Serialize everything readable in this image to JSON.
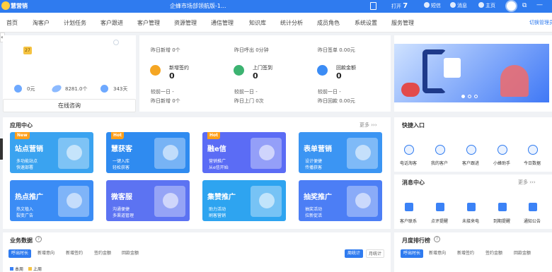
{
  "topbar": {
    "brand": "慧营销",
    "window_title": "企蜂市场部领航版-1...",
    "open_label": "打开",
    "open_count": "7",
    "items": [
      "短信",
      "消息",
      "主页"
    ]
  },
  "menu": {
    "items": [
      "首页",
      "淘客户",
      "计划任务",
      "客户跟进",
      "客户管理",
      "资源管理",
      "通信管理",
      "知识库",
      "统计分析",
      "成员角色",
      "系统设置",
      "服务管理"
    ],
    "right_link": "切换管理员"
  },
  "profile": {
    "badge": "27",
    "stats": [
      {
        "icon": "money-bag-icon",
        "value": "0元"
      },
      {
        "icon": "pill-icon",
        "value": "8281.0个"
      },
      {
        "icon": "clock-icon",
        "value": "343天"
      }
    ],
    "consult_label": "在线咨询"
  },
  "stats": {
    "top_row": [
      "昨日新增 0个",
      "昨日呼出 0分钟",
      "昨日签单 0.00元"
    ],
    "items": [
      {
        "name": "新增签约",
        "value": "0",
        "compare": "较前一日 -",
        "yesterday": "昨日新增 0个",
        "color": "#f5a623"
      },
      {
        "name": "上门签到",
        "value": "0",
        "compare": "较前一日 -",
        "yesterday": "昨日上门 0次",
        "color": "#3cb371"
      },
      {
        "name": "回款金额",
        "value": "0",
        "compare": "较前一日 -",
        "yesterday": "昨日回款 0.00元",
        "color": "#3b8cf5"
      }
    ]
  },
  "app_center": {
    "title": "应用中心",
    "more": "更多",
    "apps": [
      {
        "tag": "New",
        "name": "站点营销",
        "desc1": "多功能站点",
        "desc2": "快速部署",
        "color": "#3aa3f0"
      },
      {
        "tag": "Hot",
        "name": "慧获客",
        "desc1": "一键入库",
        "desc2": "轻松获客",
        "color": "#2f8bf0"
      },
      {
        "tag": "Hot",
        "name": "融e信",
        "desc1": "营销推广",
        "desc2": "从e信开始",
        "color": "#5b6cf5"
      },
      {
        "tag": "",
        "name": "表单营销",
        "desc1": "设计便捷",
        "desc2": "传播获客",
        "color": "#3b95f3"
      },
      {
        "tag": "",
        "name": "热点推广",
        "desc1": "热文植入",
        "desc2": "裂变广告",
        "color": "#3b8cf5"
      },
      {
        "tag": "",
        "name": "微客服",
        "desc1": "沟通便捷",
        "desc2": "多渠道管理",
        "color": "#5c73f2"
      },
      {
        "tag": "",
        "name": "集赞推广",
        "desc1": "助力活动",
        "desc2": "刷客营销",
        "color": "#2ea4f0"
      },
      {
        "tag": "",
        "name": "抽奖推广",
        "desc1": "抽奖活动",
        "desc2": "拉新促活",
        "color": "#4c7ef5"
      }
    ]
  },
  "quick_entry": {
    "title": "快捷入口",
    "items": [
      "电话淘客",
      "我的客户",
      "客户跟进",
      "小蜂助手",
      "今日数据"
    ]
  },
  "messages": {
    "title": "消息中心",
    "more": "更多",
    "items": [
      "客户联系",
      "点评提醒",
      "未接来电",
      "到期提醒",
      "通知公告"
    ]
  },
  "business": {
    "title": "业务数据",
    "tabs": [
      "呼出时长",
      "新增意向",
      "新增签约",
      "签约金额",
      "回款金额"
    ],
    "period_tabs": [
      "周统计",
      "月统计"
    ],
    "legend": [
      {
        "label": "本周",
        "color": "#3b82f6"
      },
      {
        "label": "上周",
        "color": "#f5c342"
      }
    ]
  },
  "ranking": {
    "title": "月度排行榜",
    "tabs": [
      "呼出时长",
      "新增意向",
      "新增签约",
      "签约金额",
      "回款金额"
    ]
  }
}
